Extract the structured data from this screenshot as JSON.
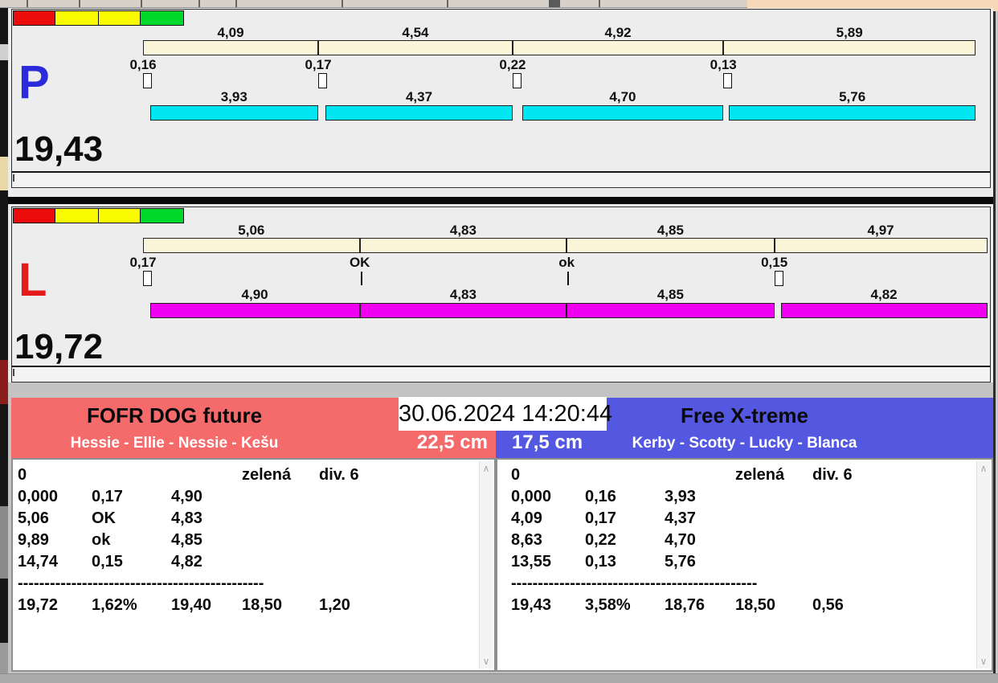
{
  "clock": "30.06.2024 14:20:44",
  "icons": {
    "scroll_up": "∧",
    "scroll_down": "∨"
  },
  "colors": {
    "split_bar": "#FBF6DA",
    "lane_p_run_bar": "#00E6F0",
    "lane_l_run_bar": "#F000F0",
    "team_left_header": "#F56B6C",
    "team_right_header": "#5458E0",
    "indicator_red": "#ED0C0C",
    "indicator_yellow": "#FAFA00",
    "indicator_green": "#00D92C"
  },
  "lanes": [
    {
      "letter": "P",
      "letter_color": "#2B2BDB",
      "total": "19,43",
      "run_bar_color": "#00E6F0",
      "indicator_colors": [
        "#ED0C0C",
        "#FAFA00",
        "#FAFA00",
        "#00D92C"
      ],
      "segments": [
        {
          "split": "4,09",
          "changeover": "0,16",
          "run": "3,93"
        },
        {
          "split": "4,54",
          "changeover": "0,17",
          "run": "4,37"
        },
        {
          "split": "4,92",
          "changeover": "0,22",
          "run": "4,70"
        },
        {
          "split": "5,89",
          "changeover": "0,13",
          "run": "5,76"
        }
      ]
    },
    {
      "letter": "L",
      "letter_color": "#E51A1A",
      "total": "19,72",
      "run_bar_color": "#F000F0",
      "indicator_colors": [
        "#ED0C0C",
        "#FAFA00",
        "#FAFA00",
        "#00D92C"
      ],
      "segments": [
        {
          "split": "5,06",
          "changeover": "0,17",
          "run": "4,90"
        },
        {
          "split": "4,83",
          "changeover": "OK",
          "run": "4,83"
        },
        {
          "split": "4,85",
          "changeover": "ok",
          "run": "4,85"
        },
        {
          "split": "4,97",
          "changeover": "0,15",
          "run": "4,82"
        }
      ]
    }
  ],
  "teams": [
    {
      "name": "FOFR DOG future",
      "dogs": "Hessie - Ellie - Nessie - Kešu",
      "jump_height": "22,5 cm",
      "header_color": "#F56B6C",
      "info": [
        "0",
        "",
        "",
        "zelená",
        "div. 6"
      ],
      "rows": [
        [
          "0,000",
          "0,17",
          "4,90",
          "",
          ""
        ],
        [
          "5,06",
          "OK",
          "4,83",
          "",
          ""
        ],
        [
          "9,89",
          "ok",
          "4,85",
          "",
          ""
        ],
        [
          "14,74",
          "0,15",
          "4,82",
          "",
          ""
        ]
      ],
      "dash_line": "----------------------------------------------",
      "totals": [
        "19,72",
        "1,62%",
        "19,40",
        "18,50",
        "1,20"
      ]
    },
    {
      "name": "Free X-treme",
      "dogs": "Kerby - Scotty - Lucky - Blanca",
      "jump_height": "17,5 cm",
      "header_color": "#5458E0",
      "info": [
        "0",
        "",
        "",
        "zelená",
        "div. 6"
      ],
      "rows": [
        [
          "0,000",
          "0,16",
          "3,93",
          "",
          ""
        ],
        [
          "4,09",
          "0,17",
          "4,37",
          "",
          ""
        ],
        [
          "8,63",
          "0,22",
          "4,70",
          "",
          ""
        ],
        [
          "13,55",
          "0,13",
          "5,76",
          "",
          ""
        ]
      ],
      "dash_line": "----------------------------------------------",
      "totals": [
        "19,43",
        "3,58%",
        "18,76",
        "18,50",
        "0,56"
      ]
    }
  ]
}
